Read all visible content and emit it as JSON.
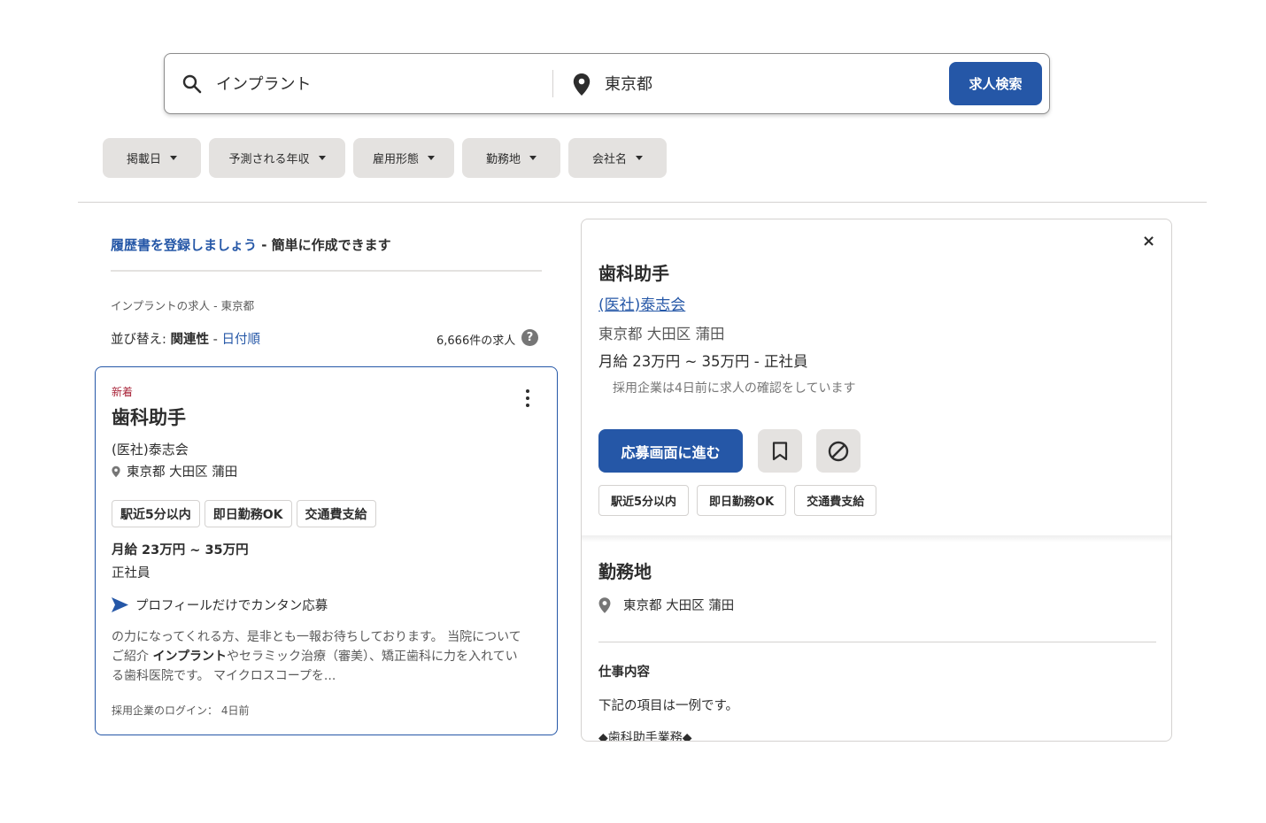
{
  "search": {
    "what_value": "インプラント",
    "where_value": "東京都",
    "button_label": "求人検索"
  },
  "filters": [
    {
      "label": "掲載日"
    },
    {
      "label": "予測される年収"
    },
    {
      "label": "雇用形態"
    },
    {
      "label": "勤務地"
    },
    {
      "label": "会社名"
    }
  ],
  "results": {
    "resume_link": "履歴書を登録しましょう",
    "resume_suffix": " - 簡単に作成できます",
    "query_caption": "インプラントの求人 - 東京都",
    "sort_prefix": "並び替え: ",
    "sort_active": "関連性",
    "sort_sep": " - ",
    "sort_alt": "日付順",
    "job_count": "6,666件の求人",
    "help_glyph": "?"
  },
  "job_card": {
    "badge": "新着",
    "title": "歯科助手",
    "company": "(医社)泰志会",
    "location": "東京都 大田区 蒲田",
    "tags": [
      "駅近5分以内",
      "即日勤務OK",
      "交通費支給"
    ],
    "salary": "月給 23万円 ~ 35万円",
    "job_type": "正社員",
    "easy_apply": "プロフィールだけでカンタン応募",
    "snippet_part1": "の力になってくれる方、是非とも一報お待ちしております。 当院についてご紹介 ",
    "snippet_keyword": "インプラント",
    "snippet_part2": "やセラミック治療（審美）、矯正歯科に力を入れている歯科医院です。 マイクロスコープを...",
    "last_login": "採用企業のログイン： 4日前"
  },
  "detail": {
    "close_glyph": "×",
    "title": "歯科助手",
    "company": "(医社)泰志会",
    "location": "東京都 大田区 蒲田",
    "salary": "月給 23万円 ~ 35万円  - 正社員",
    "checked_note": "採用企業は4日前に求人の確認をしています",
    "apply_label": "応募画面に進む",
    "tags": [
      "駅近5分以内",
      "即日勤務OK",
      "交通費支給"
    ],
    "workplace_heading": "勤務地",
    "workplace_location": "東京都 大田区 蒲田",
    "content_heading": "仕事内容",
    "content_line1": "下記の項目は一例です。",
    "content_line2": "◆歯科助手業務◆"
  },
  "colors": {
    "accent": "#2557a7",
    "new_badge": "#a9253a",
    "pill_bg": "#e4e2e0"
  },
  "icons": [
    "search-icon",
    "map-pin-icon",
    "caret-down-icon",
    "help-icon",
    "kebab-menu-icon",
    "send-icon",
    "bookmark-icon",
    "not-interested-icon",
    "close-icon"
  ]
}
